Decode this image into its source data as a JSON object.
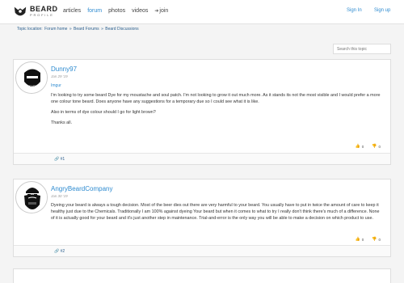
{
  "brand": {
    "name": "BEARD",
    "tagline": "PROFILE"
  },
  "nav": {
    "items": [
      {
        "label": "articles",
        "active": false
      },
      {
        "label": "forum",
        "active": true
      },
      {
        "label": "photos",
        "active": false
      },
      {
        "label": "videos",
        "active": false
      },
      {
        "label": "join",
        "active": false,
        "icon": "sign-in-icon"
      }
    ]
  },
  "auth": {
    "signin": "Sign In",
    "signup": "Sign up"
  },
  "breadcrumb": {
    "prefix": "Topic location:",
    "items": [
      "Forum home",
      "Beard Forums",
      "Beard Discussions"
    ],
    "separator": "»"
  },
  "search": {
    "placeholder": "Search this topic"
  },
  "posts": [
    {
      "author": "Dunny97",
      "date": "Jan 29 '19",
      "link": "Imgur",
      "paragraphs": [
        "I'm looking to try some beard Dye for my moustache and soul patch. I'm not looking to grow it out much more. As it stands its not the most visible and I would prefer a more one colour tone beard. Does anyone have any suggestions for a temporary due so I could see what it is like.",
        "Also in terms of dye colour should I go for light brown?",
        "Thanks all."
      ],
      "upvotes": "0",
      "downvotes": "0",
      "number": "#1"
    },
    {
      "author": "AngryBeardCompany",
      "date": "Jan 30 '19",
      "paragraphs": [
        "Dyeing your beard is always a tough decision. Most of the beer dies out there are very harmful to your beard. You usually have to put in twice the amount of care to keep it healthy just due to the Chemicals. Traditionally I am 100% against dyeing Your beard but when it comes to what to try I really don't think there's much of a difference. None of it is actually good for your beard and it's just another step in maintenance. Trial-and-error is the only way you will be able to make a decision on which product to use."
      ],
      "upvotes": "0",
      "downvotes": "0",
      "number": "#2"
    }
  ],
  "colors": {
    "link": "#2e8bd0",
    "upvote": "#2a8a2a",
    "background": "#f4f4f4"
  }
}
